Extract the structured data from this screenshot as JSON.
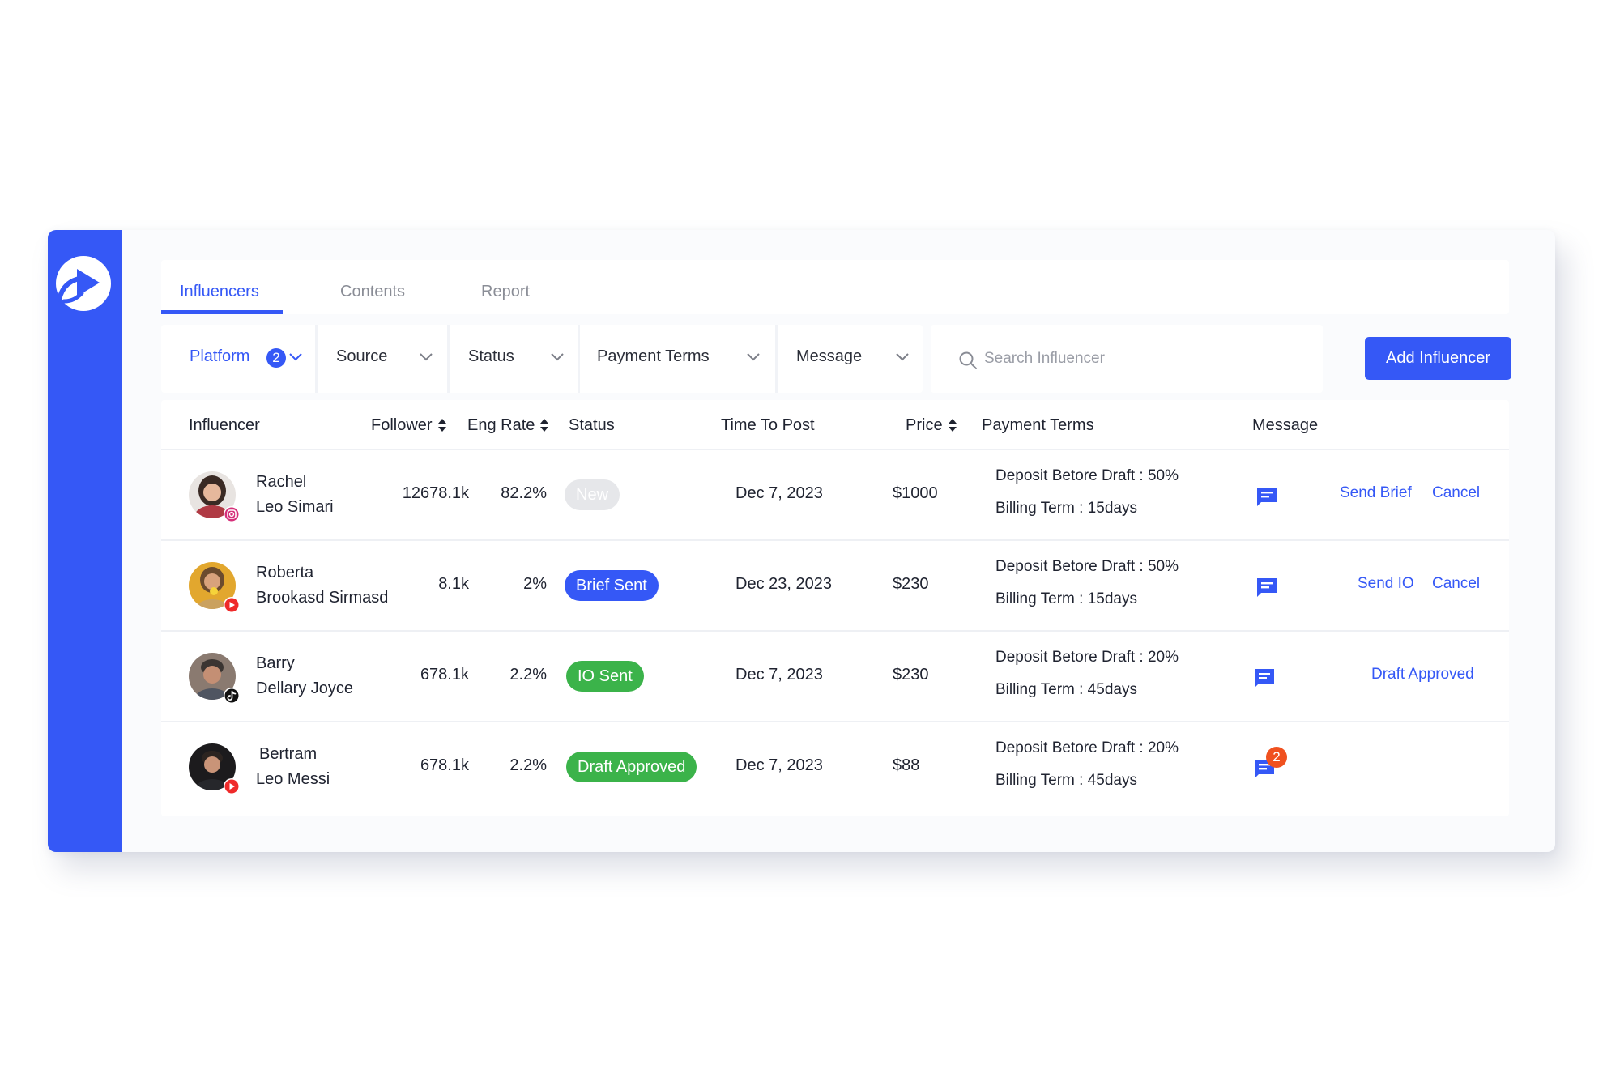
{
  "colors": {
    "accent": "#3558f6",
    "new": "#e6e7ea",
    "brief_sent": "#3558f6",
    "io_sent": "#3bb34a",
    "draft_approved": "#3bb34a",
    "message_count": "#f0511f"
  },
  "tabs": [
    {
      "label": "Influencers",
      "active": true
    },
    {
      "label": "Contents",
      "active": false
    },
    {
      "label": "Report",
      "active": false
    }
  ],
  "filters": {
    "platform": {
      "label": "Platform",
      "count": "2"
    },
    "source": {
      "label": "Source"
    },
    "status": {
      "label": "Status"
    },
    "payment_terms": {
      "label": "Payment Terms"
    },
    "message": {
      "label": "Message"
    }
  },
  "search": {
    "placeholder": "Search Influencer",
    "value": ""
  },
  "add_button_label": "Add Influencer",
  "table": {
    "headers": {
      "influencer": "Influencer",
      "follower": "Follower",
      "eng_rate": "Eng Rate",
      "status": "Status",
      "time_to_post": "Time To Post",
      "price": "Price",
      "payment_terms": "Payment Terms",
      "message": "Message"
    },
    "rows": [
      {
        "first_name": "Rachel",
        "last_name": "Leo Simari",
        "platform": "instagram-icon",
        "follower": "12678.1k",
        "eng_rate": "82.2%",
        "status": "New",
        "status_color": "#e6e7ea",
        "time_to_post": "Dec 7, 2023",
        "price": "$1000",
        "deposit": "Deposit Betore Draft : 50%",
        "billing": "Billing Term : 15days",
        "unread": "",
        "actions": [
          "Send Brief",
          "Cancel"
        ]
      },
      {
        "first_name": "Roberta",
        "last_name": "Brookasd Sirmasd",
        "platform": "youtube-icon",
        "follower": "8.1k",
        "eng_rate": "2%",
        "status": "Brief Sent",
        "status_color": "#3558f6",
        "time_to_post": "Dec 23, 2023",
        "price": "$230",
        "deposit": "Deposit Betore Draft : 50%",
        "billing": "Billing Term : 15days",
        "unread": "",
        "actions": [
          "Send IO",
          "Cancel"
        ]
      },
      {
        "first_name": "Barry",
        "last_name": "Dellary Joyce",
        "platform": "tiktok-icon",
        "follower": "678.1k",
        "eng_rate": "2.2%",
        "status": "IO Sent",
        "status_color": "#3bb34a",
        "time_to_post": "Dec 7, 2023",
        "price": "$230",
        "deposit": "Deposit Betore Draft :  20%",
        "billing": "Billing Term : 45days",
        "unread": "",
        "actions": [
          "Draft Approved"
        ]
      },
      {
        "first_name": "Bertram",
        "last_name": "Leo Messi",
        "platform": "youtube-icon",
        "follower": "678.1k",
        "eng_rate": "2.2%",
        "status": "Draft Approved",
        "status_color": "#3bb34a",
        "time_to_post": "Dec 7, 2023",
        "price": "$88",
        "deposit": "Deposit Betore Draft :  20%",
        "billing": "Billing Term : 45days",
        "unread": "2",
        "actions": []
      }
    ]
  }
}
